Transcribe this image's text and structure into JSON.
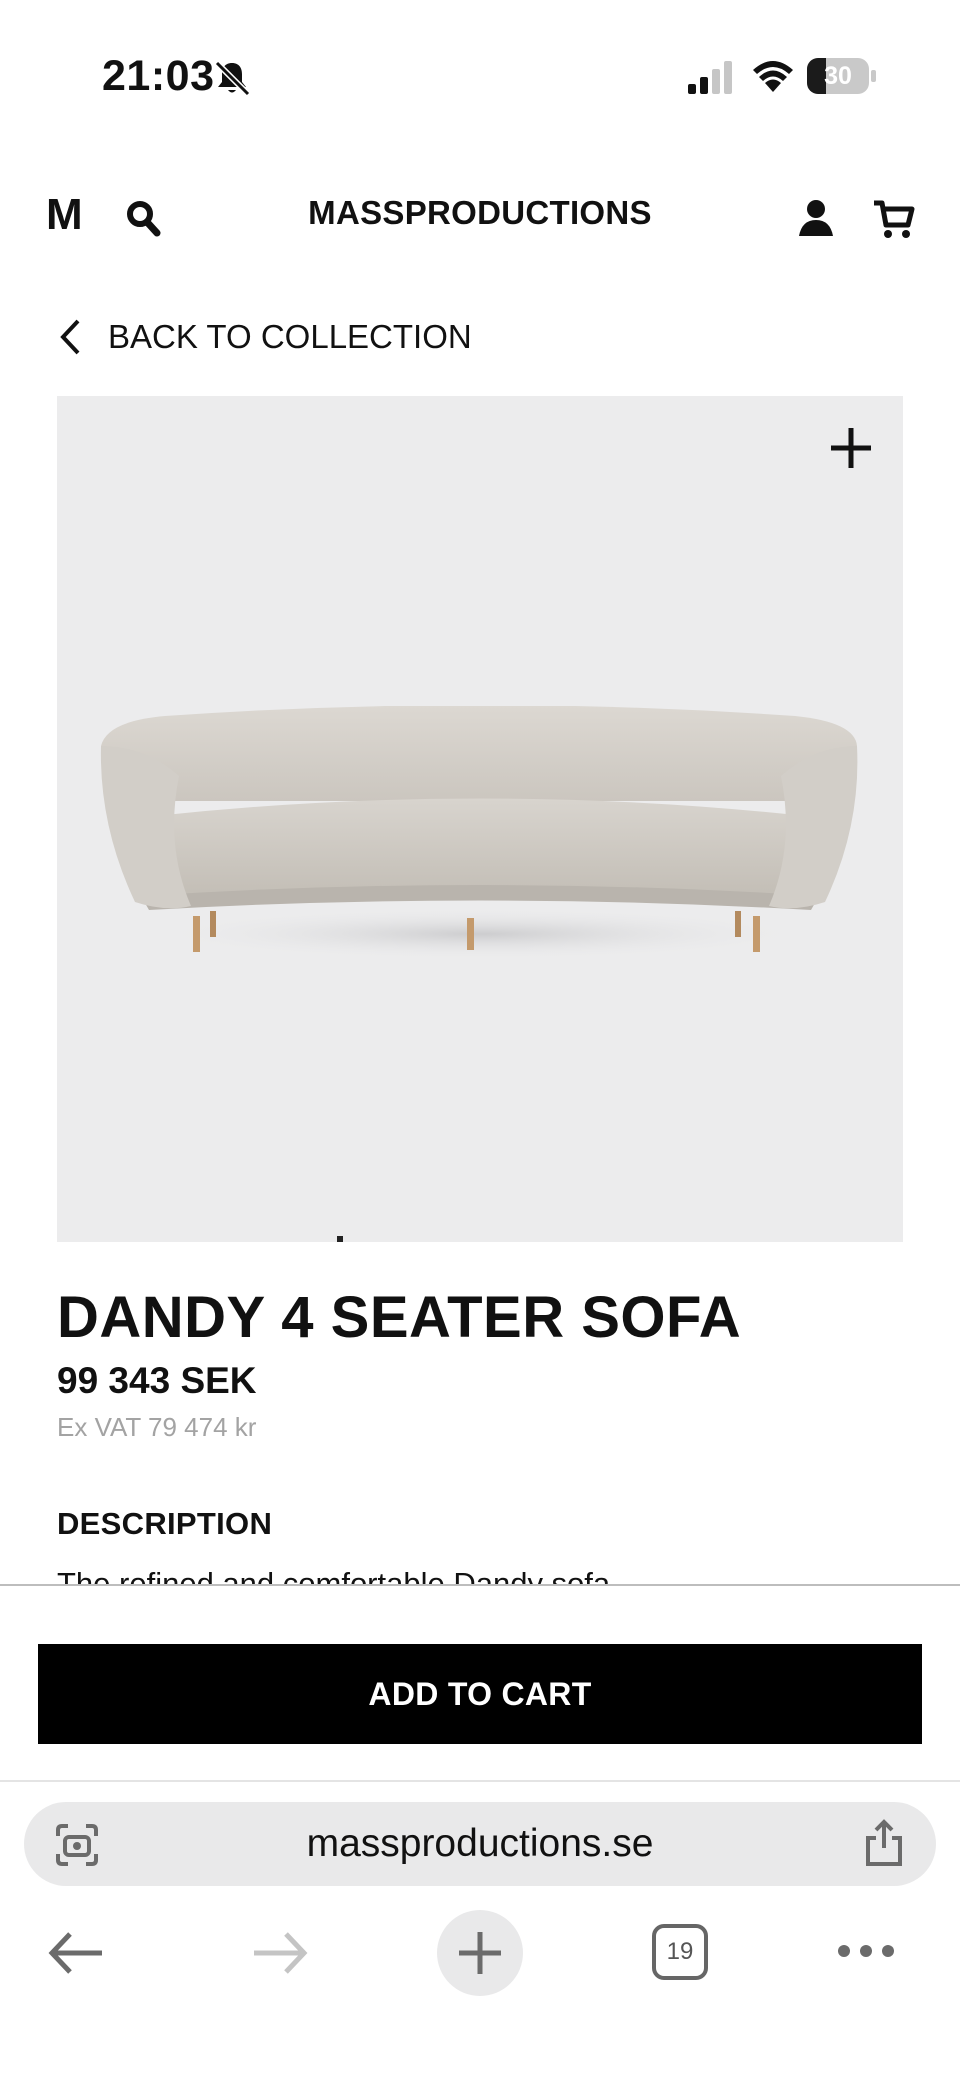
{
  "status_bar": {
    "time": "21:03",
    "battery": "30",
    "battery_level": 0.3
  },
  "header": {
    "logo": "M",
    "brand": "MASSPRODUCTIONS"
  },
  "nav": {
    "back_label": "BACK TO COLLECTION"
  },
  "product": {
    "title": "DANDY 4 SEATER SOFA",
    "price": "99 343 SEK",
    "price_ex_vat": "Ex VAT 79 474 kr",
    "description_heading": "DESCRIPTION",
    "description_text": "The refined and comfortable Dandy sofa"
  },
  "cart": {
    "add_label": "ADD TO CART"
  },
  "browser": {
    "url": "massproductions.se",
    "tab_count": "19"
  },
  "colors": {
    "button_bg": "#000000",
    "image_bg": "#ececed",
    "url_bar_bg": "#e9e9ea"
  },
  "icons": {
    "status": [
      "bell-slash-icon",
      "signal-icon",
      "wifi-icon",
      "battery-icon"
    ],
    "header": [
      "search-icon",
      "account-icon",
      "cart-icon"
    ],
    "browser": [
      "page-settings-icon",
      "share-icon",
      "back-arrow-icon",
      "forward-arrow-icon",
      "plus-icon",
      "more-icon"
    ]
  }
}
